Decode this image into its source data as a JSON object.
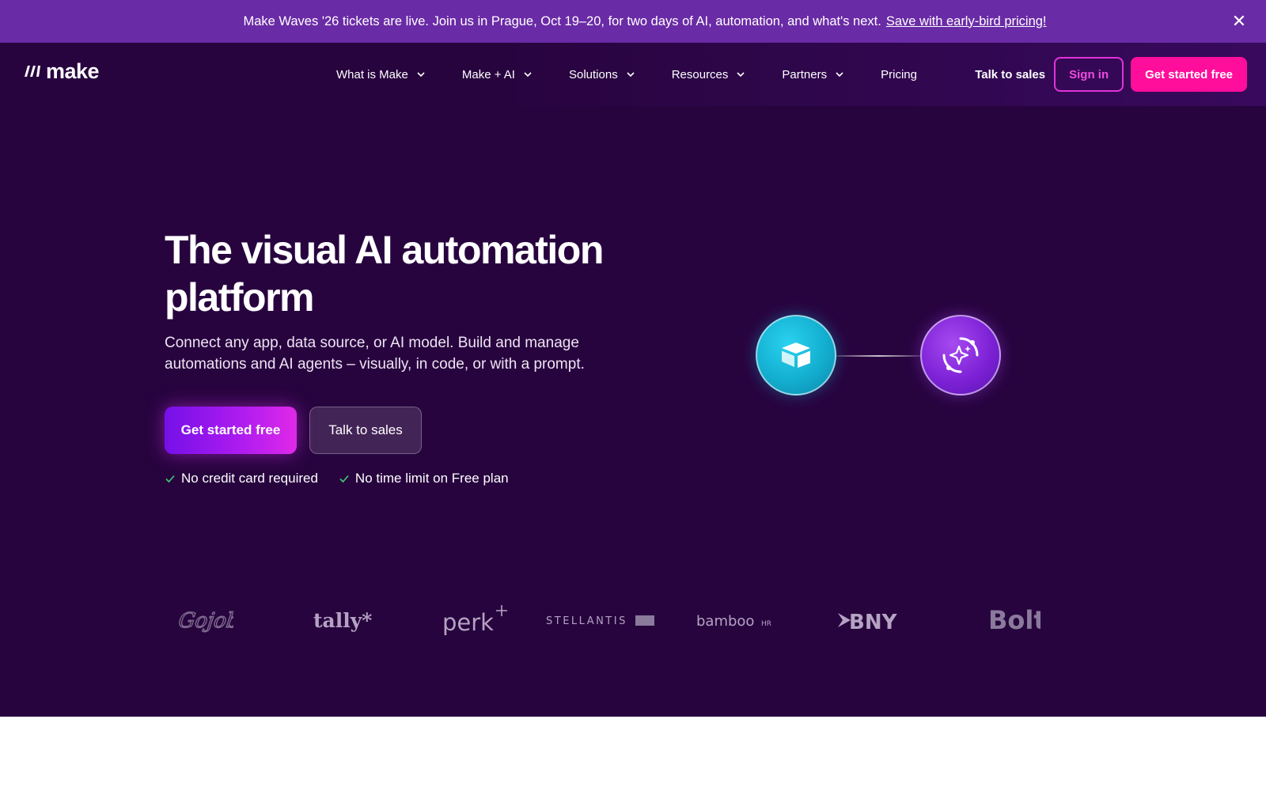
{
  "banner": {
    "text": "Make Waves '26 tickets are live. Join us in Prague, Oct 19–20, for two days of AI, automation, and what's next.",
    "link": "Save with early-bird pricing!",
    "close_icon": "close-icon"
  },
  "nav": {
    "logo": "make",
    "items": [
      {
        "label": "What is Make",
        "dropdown": true
      },
      {
        "label": "Make + AI",
        "dropdown": true
      },
      {
        "label": "Solutions",
        "dropdown": true
      },
      {
        "label": "Resources",
        "dropdown": true
      },
      {
        "label": "Partners",
        "dropdown": true
      },
      {
        "label": "Pricing",
        "dropdown": false
      }
    ],
    "talk_to_sales": "Talk to sales",
    "sign_in": "Sign in",
    "get_started": "Get started free"
  },
  "hero": {
    "title_line1": "The visual AI automation",
    "title_line2": "platform",
    "subtitle_line1": "Connect any app, data source, or AI model. Build and manage",
    "subtitle_line2": "automations and AI agents – visually, in code, or with a prompt.",
    "cta_primary": "Get started free",
    "cta_secondary": "Talk to sales",
    "checks": [
      "No credit card required",
      "No time limit on Free plan"
    ]
  },
  "flow": {
    "nodes": [
      {
        "icon": "airtable-icon",
        "color": "#18b4d6"
      },
      {
        "icon": "ai-sparkle-icon",
        "color": "#8a2be2"
      }
    ]
  },
  "logos": [
    "Gojob",
    "tally*",
    "perk",
    "STELLANTIS",
    "bambooHR",
    "BNY",
    "Bolt"
  ],
  "colors": {
    "banner_bg": "#6a2ba6",
    "hero_bg": "#28043f",
    "accent_pink": "#ff0d9b",
    "sign_in_border": "#e233d8"
  }
}
